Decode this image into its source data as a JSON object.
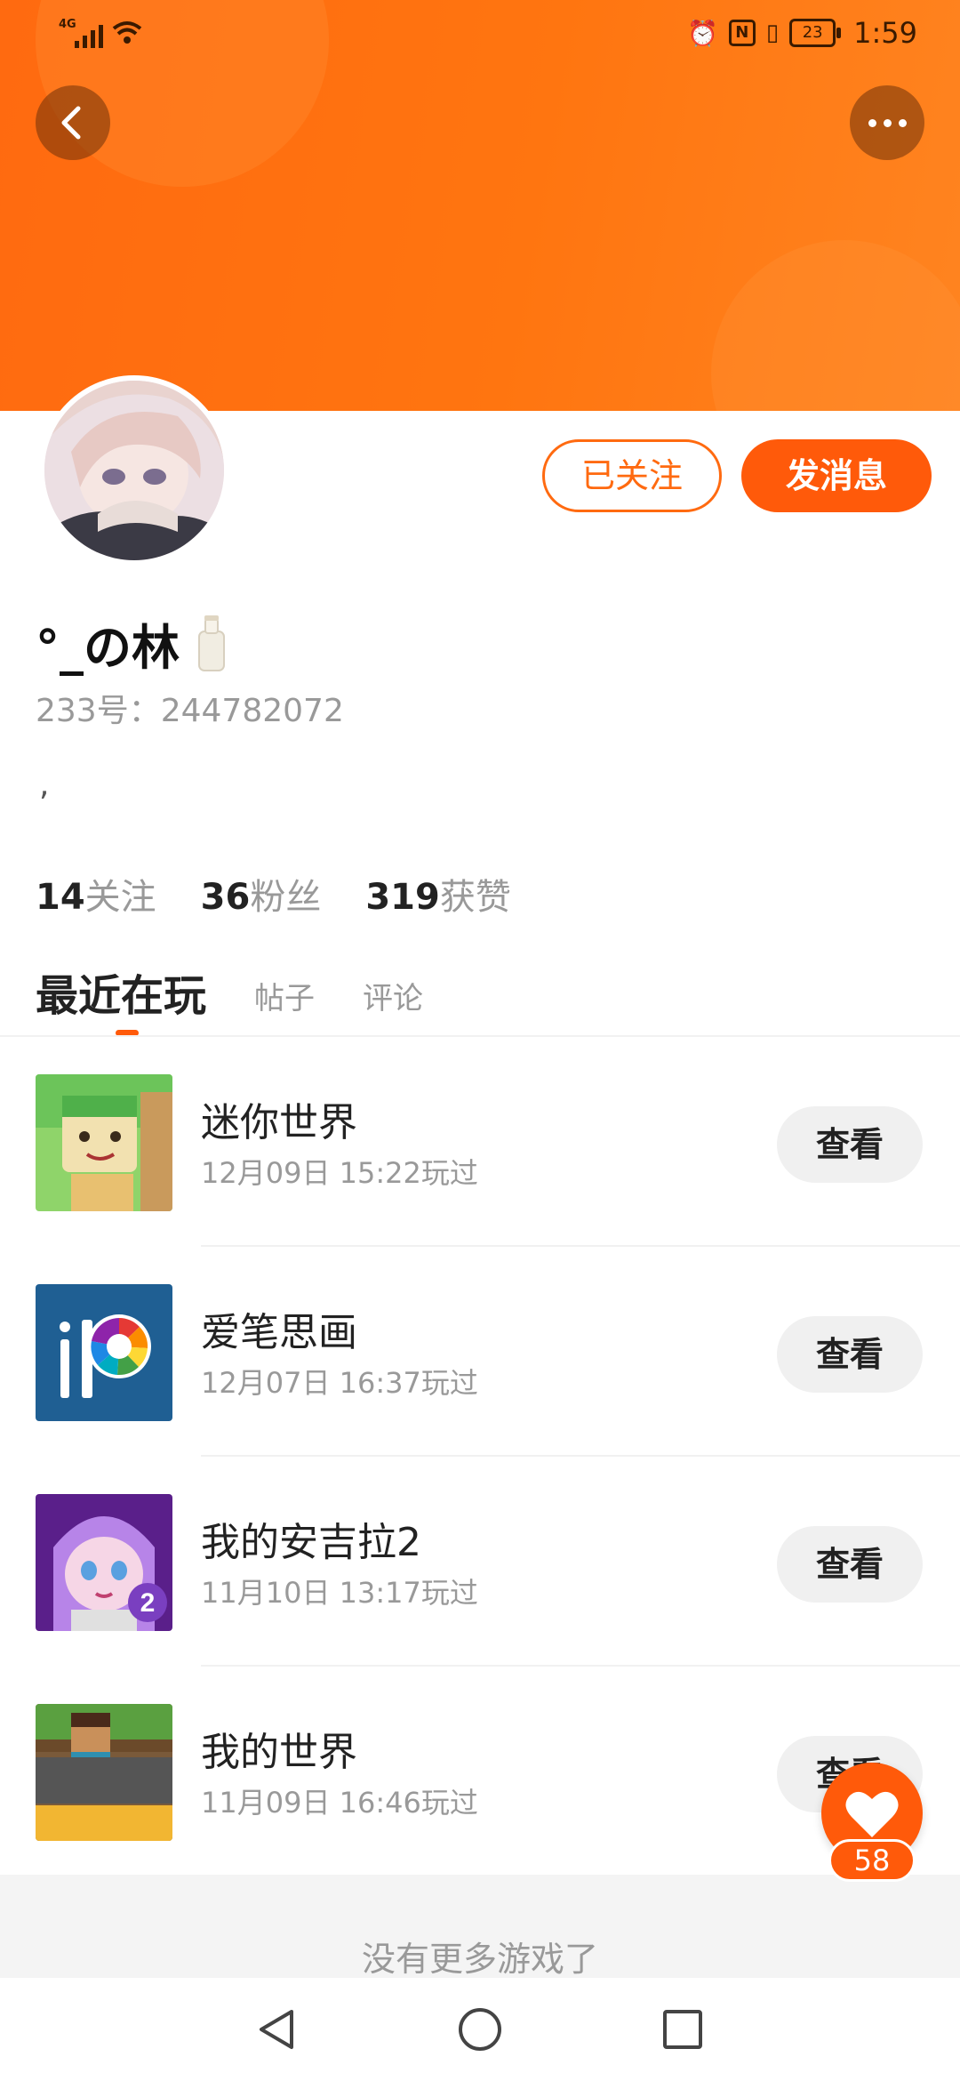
{
  "status_bar": {
    "network": "4G",
    "battery": "23",
    "time": "1:59",
    "nfc": "N"
  },
  "header": {
    "back_icon": "chevron-left-icon",
    "more_icon": "more-horizontal-icon"
  },
  "profile": {
    "name": "°_の林",
    "name_emoji": "milk-bottle-icon",
    "uid": "233号：244782072",
    "bio": ",",
    "follow_button": "已关注",
    "message_button": "发消息"
  },
  "stats": {
    "following_count": "14",
    "following_label": "关注",
    "followers_count": "36",
    "followers_label": "粉丝",
    "likes_count": "319",
    "likes_label": "获赞"
  },
  "tabs": [
    {
      "label": "最近在玩",
      "active": true
    },
    {
      "label": "帖子",
      "active": false
    },
    {
      "label": "评论",
      "active": false
    }
  ],
  "games": [
    {
      "title": "迷你世界",
      "time": "12月09日 15:22玩过",
      "action": "查看"
    },
    {
      "title": "爱笔思画",
      "time": "12月07日 16:37玩过",
      "action": "查看"
    },
    {
      "title": "我的安吉拉2",
      "time": "11月10日 13:17玩过",
      "action": "查看"
    },
    {
      "title": "我的世界",
      "time": "11月09日 16:46玩过",
      "action": "查看"
    }
  ],
  "footer_text": "没有更多游戏了",
  "like_fab": {
    "icon": "heart-icon",
    "count": "58"
  },
  "colors": {
    "accent": "#ff5a0a",
    "header": "#ff7510"
  }
}
